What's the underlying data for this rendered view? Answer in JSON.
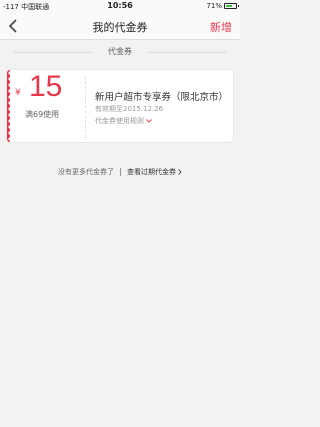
{
  "status_bar": {
    "carrier": "-117 中国联通",
    "time": "10:56",
    "battery_text": "71%",
    "battery_level": 0.71
  },
  "nav": {
    "title": "我的代金券",
    "action": "新增"
  },
  "section": {
    "title": "代金券"
  },
  "coupon": {
    "currency": "¥",
    "amount": "15",
    "condition": "满69使用",
    "name": "新用户超市专享券（限北京市）",
    "validity": "有效期至2015.12.26",
    "rules": "代金券使用规则"
  },
  "footer": {
    "no_more": "没有更多代金券了",
    "expired_link": "查看过期代金券"
  },
  "colors": {
    "accent": "#e8374a"
  }
}
